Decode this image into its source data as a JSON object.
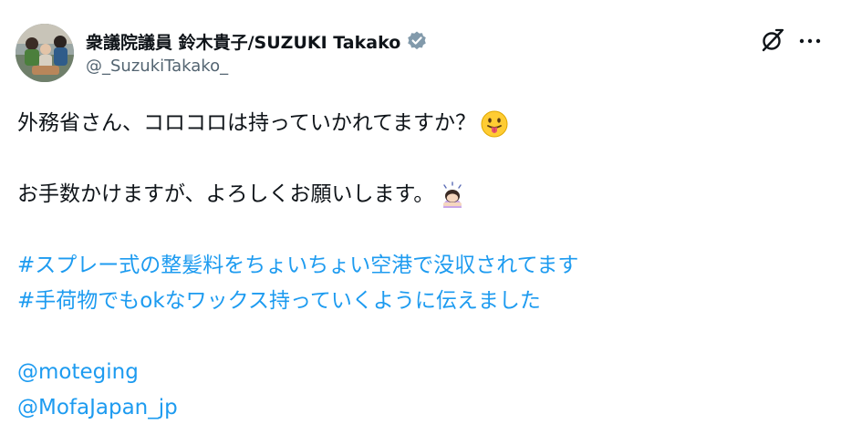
{
  "author": {
    "display_name": "衆議院議員 鈴木貴子/SUZUKI Takako",
    "handle": "@_SuzukiTakako_",
    "verified": true
  },
  "icons": {
    "verified": "verified-badge-icon",
    "grok": "grok-icon",
    "more": "more-options-icon"
  },
  "colors": {
    "link": "#1d9bf0",
    "text": "#0f1419",
    "muted": "#536471",
    "verified": "#829aab"
  },
  "tweet": {
    "line1": "外務省さん、コロコロは持っていかれてますか？",
    "line1_emoji": "face-with-tongue",
    "line2": "お手数かけますが、よろしくお願いします。",
    "line2_emoji": "person-bowing",
    "hashtag1": "#スプレー式の整髪料をちょいちょい空港で没収されてます",
    "hashtag2": "#手荷物でもokなワックス持っていくように伝えました",
    "mention1": "@moteging",
    "mention2": "@MofaJapan_jp"
  }
}
